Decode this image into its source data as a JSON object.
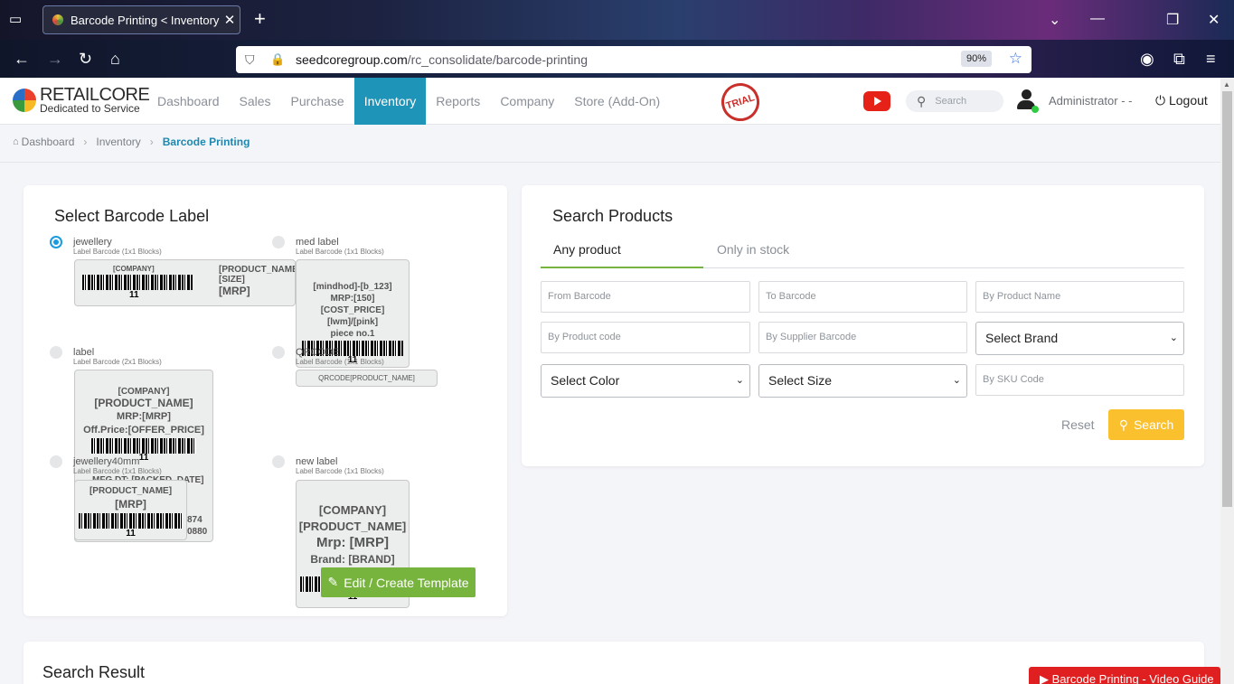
{
  "browser": {
    "tab_title": "Barcode Printing < Inventory | R",
    "url_host": "seedcoregroup.com",
    "url_path": "/rc_consolidate/barcode-printing",
    "zoom": "90%"
  },
  "header": {
    "brand": "RETAILCORE",
    "tagline": "Dedicated to Service",
    "nav": [
      "Dashboard",
      "Sales",
      "Purchase",
      "Inventory",
      "Reports",
      "Company",
      "Store (Add-On)"
    ],
    "active_nav": "Inventory",
    "trial_badge": "TRIAL",
    "search_placeholder": "Search",
    "user": "Administrator - -",
    "logout": "Logout"
  },
  "breadcrumb": [
    "Dashboard",
    "Inventory",
    "Barcode Printing"
  ],
  "labels_panel": {
    "title": "Select Barcode Label",
    "labels": [
      {
        "name": "jewellery",
        "sub": "Label Barcode (1x1 Blocks)",
        "checked": true,
        "lines": [
          "[COMPANY]",
          "[PRODUCT_NAME]",
          "[SIZE]",
          "[MRP]"
        ],
        "num": "11"
      },
      {
        "name": "med label",
        "sub": "Label Barcode (1x1 Blocks)",
        "checked": false,
        "lines": [
          "[mindhod]-[b_123]",
          "MRP:[150]",
          "[COST_PRICE]",
          "[lwm]/[pink]",
          "piece no.1"
        ],
        "num": "11"
      },
      {
        "name": "label",
        "sub": "Label Barcode (2x1 Blocks)",
        "checked": false,
        "lines": [
          "[COMPANY]",
          "[PRODUCT_NAME]",
          "MRP:[MRP]",
          "Off.Price:[OFFER_PRICE]"
        ],
        "num": "11"
      },
      {
        "name": "QRCODE",
        "sub": "Label Barcode (1x1 Blocks)",
        "checked": false,
        "lines": [
          "QRCODE[PRODUCT_NAME] VALUES[MRP]"
        ],
        "num": "11"
      },
      {
        "name": "jewellery40mm",
        "sub": "Label Barcode (1x1 Blocks)",
        "checked": false,
        "lines": [
          "[PRODUCT_NAME]",
          "[MRP]",
          "MFG DT: [PACKED_DATE]",
          "874",
          "0880"
        ],
        "num": "11"
      },
      {
        "name": "new label",
        "sub": "Label Barcode (1x1 Blocks)",
        "checked": false,
        "lines": [
          "[COMPANY]",
          "[PRODUCT_NAME]",
          "Mrp: [MRP]",
          "Brand: [BRAND]"
        ],
        "num": "11"
      }
    ],
    "edit_button": "Edit / Create Template"
  },
  "search_panel": {
    "title": "Search Products",
    "tabs": [
      "Any product",
      "Only in stock"
    ],
    "fields": {
      "from_barcode": "From Barcode",
      "to_barcode": "To Barcode",
      "product_name": "By Product Name",
      "product_code": "By Product code",
      "supplier_barcode": "By Supplier Barcode",
      "brand": "Select Brand",
      "color": "Select Color",
      "size": "Select Size",
      "sku": "By SKU Code"
    },
    "reset": "Reset",
    "search": "Search"
  },
  "result_panel": {
    "title": "Search Result"
  },
  "video_guide": "Barcode Printing - Video Guide",
  "colors": {
    "active_nav": "#1e94b8",
    "edit_button": "#77b43d",
    "search_button": "#fbc02d",
    "radio_checked": "#1a9be0"
  }
}
